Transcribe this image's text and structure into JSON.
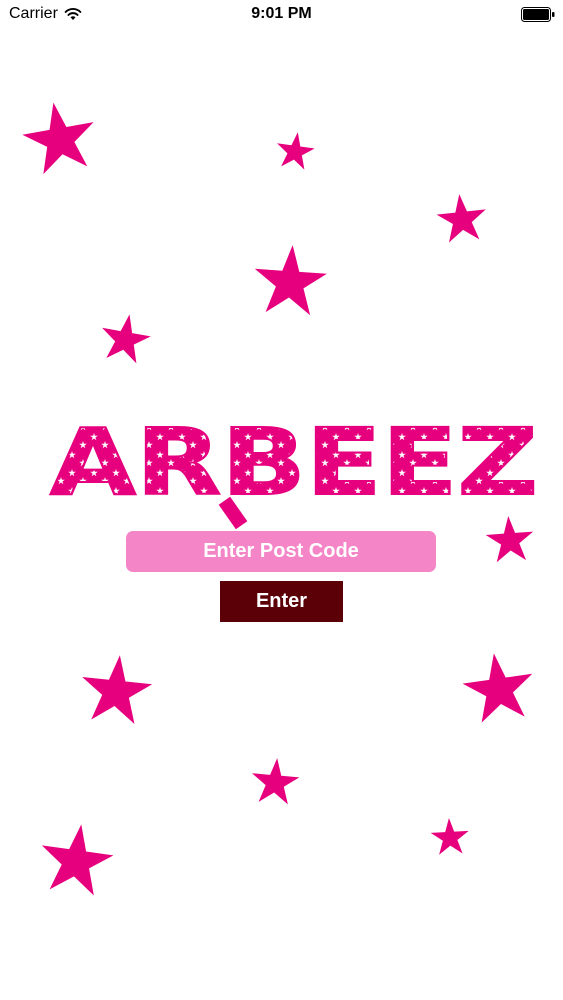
{
  "status_bar": {
    "carrier": "Carrier",
    "time": "9:01 PM",
    "wifi_icon": "wifi-icon",
    "battery_icon": "battery-icon"
  },
  "logo": {
    "text": "ARBEEZ",
    "color": "#e6007e"
  },
  "postcode": {
    "placeholder": "Enter Post Code",
    "value": ""
  },
  "enter_button": {
    "label": "Enter"
  },
  "colors": {
    "star": "#e6007e",
    "input_bg": "#f485c7",
    "button_bg": "#5c0008",
    "background": "#ffffff"
  }
}
